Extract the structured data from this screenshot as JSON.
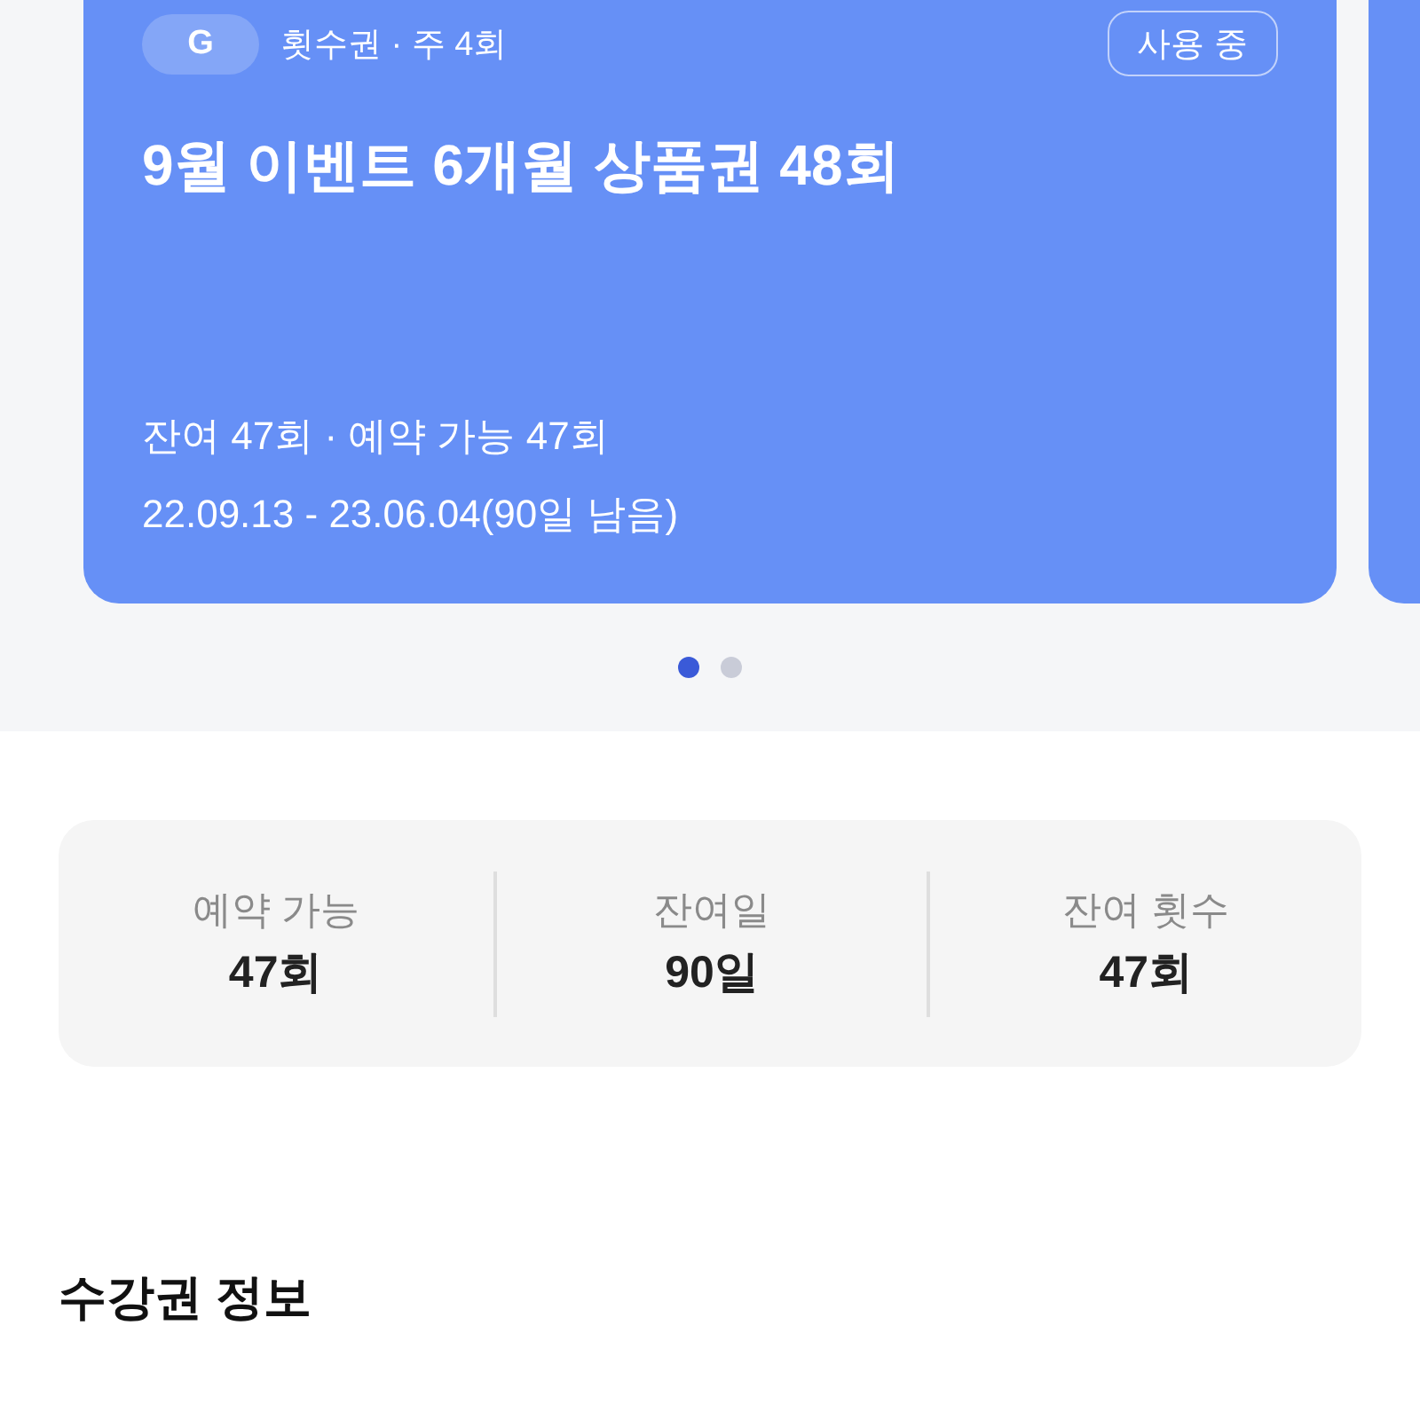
{
  "carousel": {
    "cards": [
      {
        "badge": "G",
        "pass_type": "횟수권 · 주 4회",
        "status": "사용 중",
        "title": "9월 이벤트 6개월 상품권 48회",
        "remaining": "잔여 47회 · 예약 가능 47회",
        "period": "22.09.13 - 23.06.04(90일 남음)"
      }
    ],
    "pager": [
      {
        "selected": true
      },
      {
        "selected": false
      }
    ]
  },
  "stats": [
    {
      "label": "예약 가능",
      "value": "47회"
    },
    {
      "label": "잔여일",
      "value": "90일"
    },
    {
      "label": "잔여 횟수",
      "value": "47회"
    }
  ],
  "section_title": "수강권 정보"
}
